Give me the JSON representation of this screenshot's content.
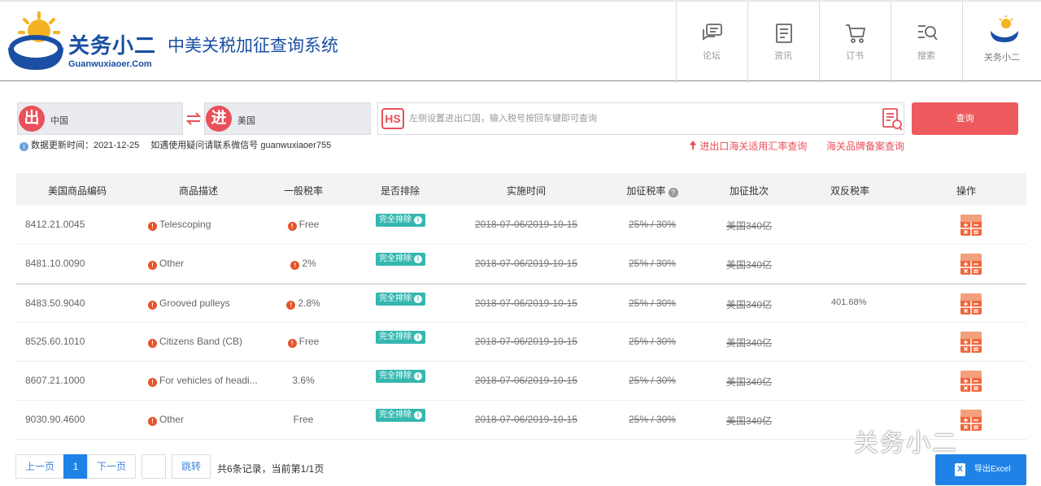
{
  "header": {
    "brand": "关务小二",
    "brand_sub": "Guanwuxiaoer.Com",
    "system_title": "中美关税加征查询系统",
    "nav": [
      {
        "label": "论坛",
        "icon": "forum-icon"
      },
      {
        "label": "资讯",
        "icon": "news-icon"
      },
      {
        "label": "订书",
        "icon": "cart-icon"
      },
      {
        "label": "搜索",
        "icon": "search-icon"
      },
      {
        "label": "关务小二",
        "icon": "brand-logo-icon"
      }
    ]
  },
  "search": {
    "export_badge": "出",
    "export_country": "中国",
    "import_badge": "进",
    "import_country": "美国",
    "hs_label": "HS",
    "placeholder": "左侧设置进出口国，输入税号按回车键即可查询",
    "query_button": "查询",
    "update_time": "数据更新时间：2021-12-25",
    "contact": "如遇使用疑问请联系微信号 guanwuxiaoer755",
    "link_exchange": "进出口海关适用汇率查询",
    "link_brand": "海关品牌备案查询"
  },
  "table": {
    "headers": [
      "美国商品编码",
      "商品描述",
      "一般税率",
      "是否排除",
      "实施时间",
      "加征税率",
      "加征批次",
      "双反税率",
      "操作"
    ],
    "rows": [
      {
        "code": "8412.21.0045",
        "desc": "Telescoping",
        "rate": "Free",
        "rate_dot": true,
        "excluded": "完全排除",
        "period": "2018-07-06/2019-10-15",
        "add_rate": "25% / 30%",
        "batch": "美国340亿",
        "ad_cvd": ""
      },
      {
        "code": "8481.10.0090",
        "desc": "Other",
        "rate": "2%",
        "rate_dot": true,
        "excluded": "完全排除",
        "period": "2018-07-06/2019-10-15",
        "add_rate": "25% / 30%",
        "batch": "美国340亿",
        "ad_cvd": ""
      },
      {
        "code": "8483.50.9040",
        "desc": "Grooved pulleys",
        "rate": "2.8%",
        "rate_dot": true,
        "excluded": "完全排除",
        "period": "2018-07-06/2019-10-15",
        "add_rate": "25% / 30%",
        "batch": "美国340亿",
        "ad_cvd": "401.68%"
      },
      {
        "code": "8525.60.1010",
        "desc": "Citizens Band (CB)",
        "rate": "Free",
        "rate_dot": true,
        "excluded": "完全排除",
        "period": "2018-07-06/2019-10-15",
        "add_rate": "25% / 30%",
        "batch": "美国340亿",
        "ad_cvd": ""
      },
      {
        "code": "8607.21.1000",
        "desc": "For vehicles of headi...",
        "rate": "3.6%",
        "rate_dot": false,
        "excluded": "完全排除",
        "period": "2018-07-06/2019-10-15",
        "add_rate": "25% / 30%",
        "batch": "美国340亿",
        "ad_cvd": ""
      },
      {
        "code": "9030.90.4600",
        "desc": "Other",
        "rate": "Free",
        "rate_dot": false,
        "excluded": "完全排除",
        "period": "2018-07-06/2019-10-15",
        "add_rate": "25% / 30%",
        "batch": "美国340亿",
        "ad_cvd": ""
      }
    ]
  },
  "pagination": {
    "prev": "上一页",
    "current": "1",
    "next": "下一页",
    "jump": "跳转",
    "info": "共6条记录，当前第1/1页"
  },
  "export_button": "导出Excel",
  "watermark": "关务小二",
  "colors": {
    "accent_red": "#ef5a5e",
    "brand_blue": "#1a4fa3",
    "tag_teal": "#35b7b0",
    "button_blue": "#1e82e6"
  }
}
